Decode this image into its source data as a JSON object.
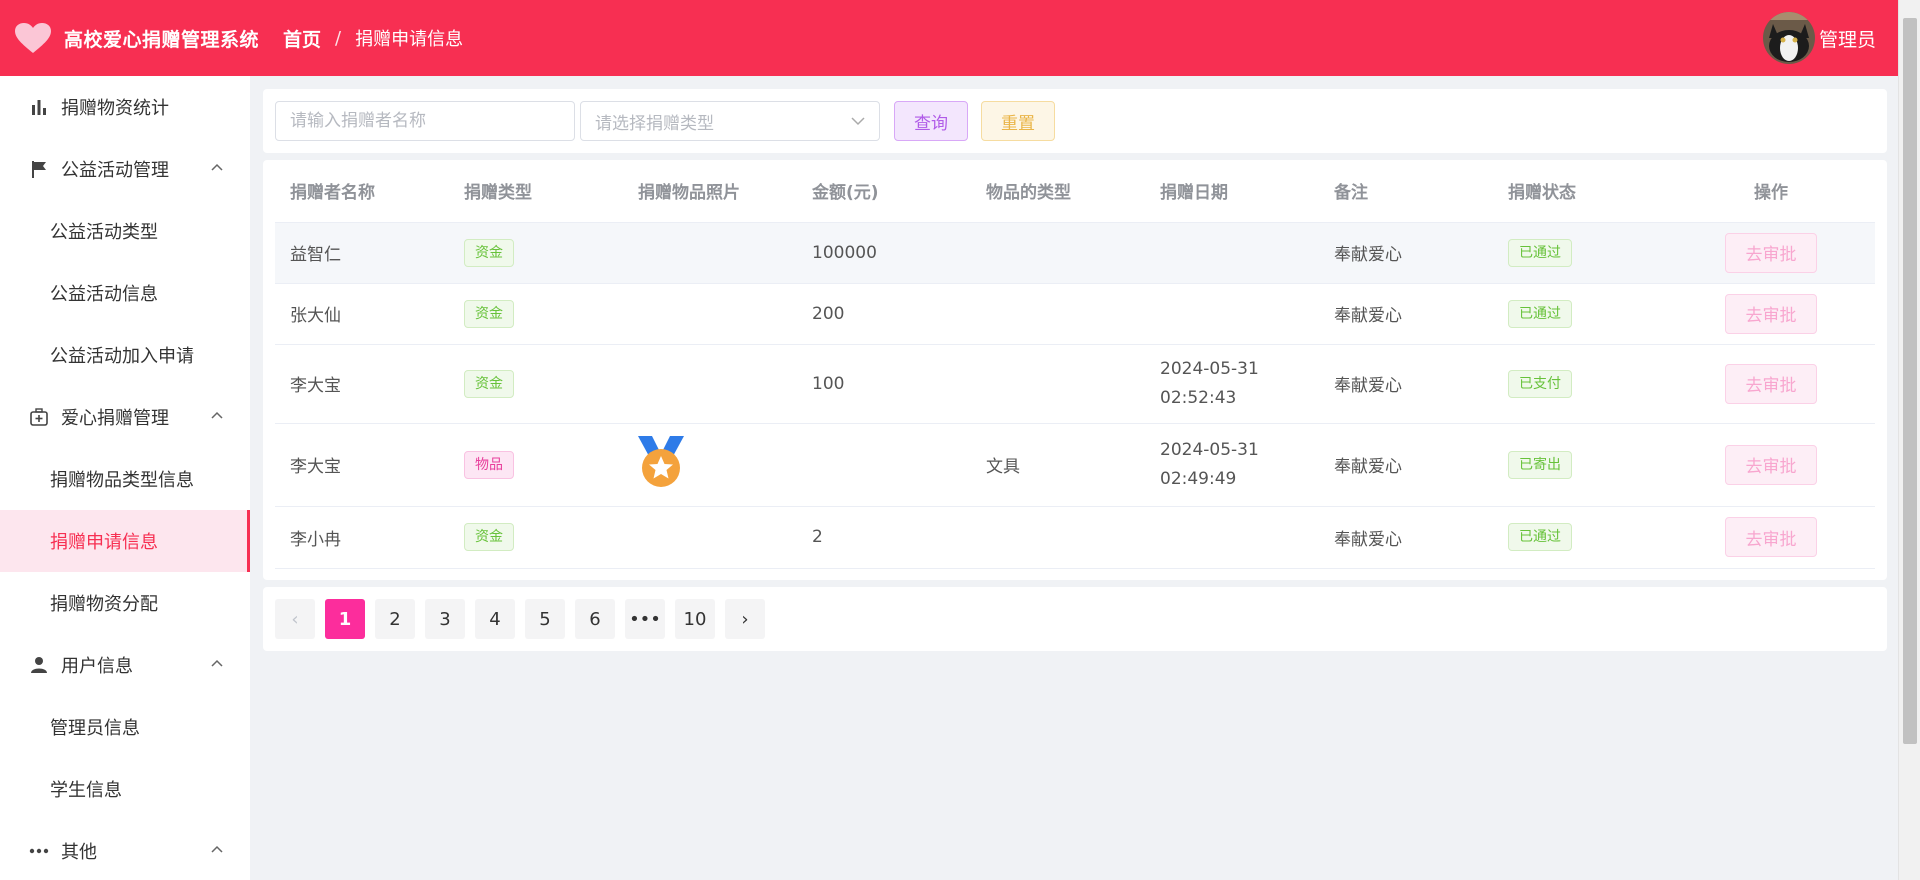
{
  "header": {
    "app_title": "高校爱心捐赠管理系统",
    "breadcrumb": {
      "home": "首页",
      "separator": "/",
      "current": "捐赠申请信息"
    },
    "user_name": "管理员",
    "brand_color": "#f72f52"
  },
  "sidebar": {
    "items": [
      {
        "label": "捐赠物资统计",
        "icon": "bar-chart-icon",
        "level": "top"
      },
      {
        "label": "公益活动管理",
        "icon": "flag-icon",
        "level": "top",
        "expanded": true
      },
      {
        "label": "公益活动类型",
        "level": "sub"
      },
      {
        "label": "公益活动信息",
        "level": "sub"
      },
      {
        "label": "公益活动加入申请",
        "level": "sub"
      },
      {
        "label": "爱心捐赠管理",
        "icon": "first-aid-kit-icon",
        "level": "top",
        "expanded": true
      },
      {
        "label": "捐赠物品类型信息",
        "level": "sub"
      },
      {
        "label": "捐赠申请信息",
        "level": "sub",
        "active": true
      },
      {
        "label": "捐赠物资分配",
        "level": "sub"
      },
      {
        "label": "用户信息",
        "icon": "user-icon",
        "level": "top",
        "expanded": true
      },
      {
        "label": "管理员信息",
        "level": "sub"
      },
      {
        "label": "学生信息",
        "level": "sub"
      },
      {
        "label": "其他",
        "icon": "more-dots-icon",
        "level": "top",
        "expanded": true
      }
    ]
  },
  "search": {
    "name_placeholder": "请输入捐赠者名称",
    "type_placeholder": "请选择捐赠类型",
    "query_label": "查询",
    "reset_label": "重置"
  },
  "table": {
    "columns": [
      "捐赠者名称",
      "捐赠类型",
      "捐赠物品照片",
      "金额(元)",
      "物品的类型",
      "捐赠日期",
      "备注",
      "捐赠状态",
      "操作"
    ],
    "rows": [
      {
        "name": "益智仁",
        "type": "资金",
        "type_style": "green",
        "photo": "",
        "amount": "100000",
        "item_type": "",
        "date": "",
        "time": "",
        "remark": "奉献爱心",
        "status": "已通过",
        "action": "去审批"
      },
      {
        "name": "张大仙",
        "type": "资金",
        "type_style": "green",
        "photo": "",
        "amount": "200",
        "item_type": "",
        "date": "",
        "time": "",
        "remark": "奉献爱心",
        "status": "已通过",
        "action": "去审批"
      },
      {
        "name": "李大宝",
        "type": "资金",
        "type_style": "green",
        "photo": "",
        "amount": "100",
        "item_type": "",
        "date": "2024-05-31",
        "time": "02:52:43",
        "remark": "奉献爱心",
        "status": "已支付",
        "action": "去审批"
      },
      {
        "name": "李大宝",
        "type": "物品",
        "type_style": "pink",
        "photo": "medal-icon",
        "amount": "",
        "item_type": "文具",
        "date": "2024-05-31",
        "time": "02:49:49",
        "remark": "奉献爱心",
        "status": "已寄出",
        "action": "去审批"
      },
      {
        "name": "李小冉",
        "type": "资金",
        "type_style": "green",
        "photo": "",
        "amount": "2",
        "item_type": "",
        "date": "",
        "time": "",
        "remark": "奉献爱心",
        "status": "已通过",
        "action": "去审批"
      }
    ]
  },
  "pagination": {
    "prev": "‹",
    "pages": [
      "1",
      "2",
      "3",
      "4",
      "5",
      "6",
      "•••",
      "10"
    ],
    "current": "1",
    "next": "›"
  }
}
